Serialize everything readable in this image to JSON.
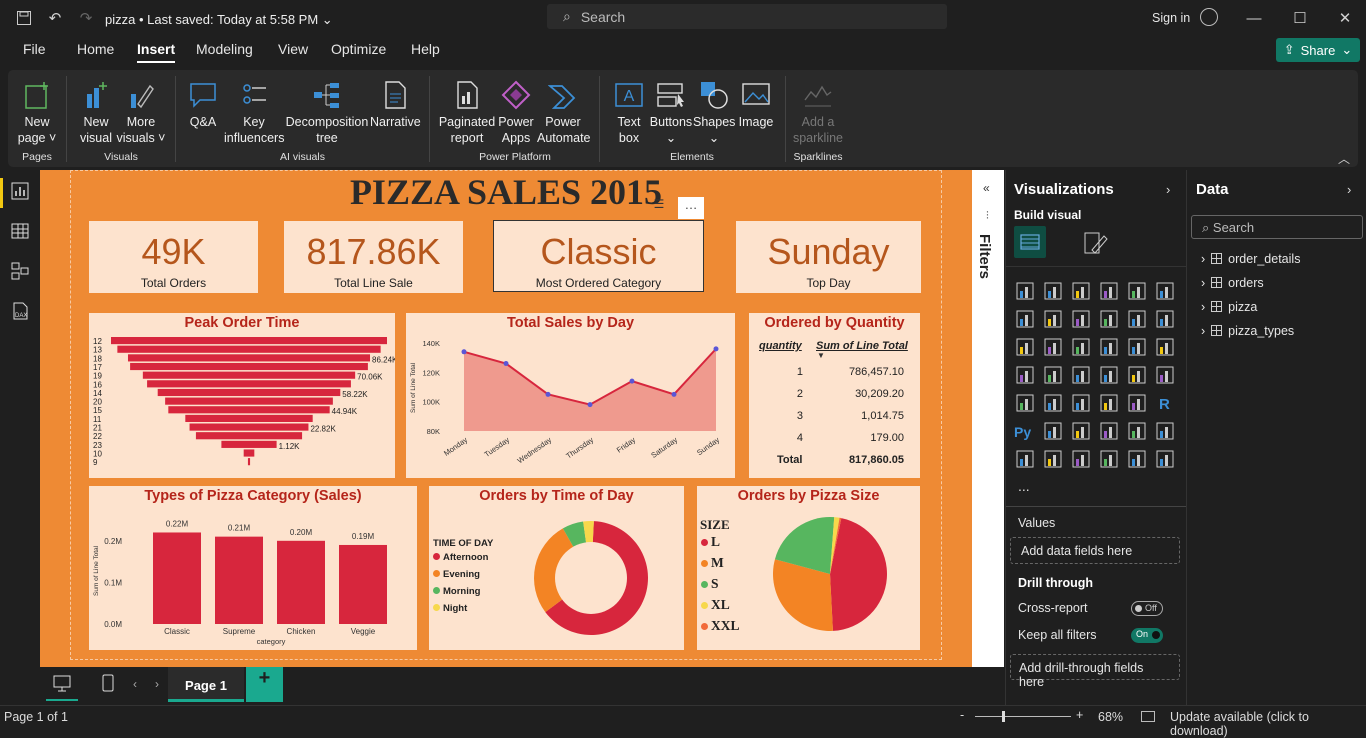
{
  "titlebar": {
    "file_name": "pizza",
    "saved": "Last saved: Today at 5:58 PM",
    "search_placeholder": "Search",
    "sign_in": "Sign in"
  },
  "menu": {
    "items": [
      "File",
      "Home",
      "Insert",
      "Modeling",
      "View",
      "Optimize",
      "Help"
    ],
    "active": "Insert",
    "share": "Share"
  },
  "ribbon": {
    "pages": {
      "new_page": [
        "New",
        "page ˅"
      ],
      "group": "Pages"
    },
    "visuals": {
      "new_visual": [
        "New",
        "visual"
      ],
      "more_visuals": [
        "More",
        "visuals ˅"
      ],
      "group": "Visuals"
    },
    "ai": {
      "qa": "Q&A",
      "key": [
        "Key",
        "influencers"
      ],
      "decomp": [
        "Decomposition",
        "tree"
      ],
      "narrative": "Narrative",
      "group": "AI visuals"
    },
    "power": {
      "paginated": [
        "Paginated",
        "report"
      ],
      "apps": [
        "Power",
        "Apps"
      ],
      "automate": [
        "Power",
        "Automate"
      ],
      "group": "Power Platform"
    },
    "elements": {
      "text": [
        "Text",
        "box"
      ],
      "buttons": "Buttons",
      "shapes": "Shapes",
      "image": "Image",
      "group": "Elements"
    },
    "sparklines": {
      "add": [
        "Add a",
        "sparkline"
      ],
      "group": "Sparklines"
    }
  },
  "report": {
    "title": "PIZZA SALES 2015",
    "kpis": [
      {
        "value": "49K",
        "label": "Total Orders"
      },
      {
        "value": "817.86K",
        "label": "Total Line Sale"
      },
      {
        "value": "Classic",
        "label": "Most Ordered Category"
      },
      {
        "value": "Sunday",
        "label": "Top Day"
      }
    ],
    "colors": {
      "canvas": "#ee8a34",
      "card": "#fde3ce",
      "accent": "#d7263d",
      "title_red": "#b5251a"
    }
  },
  "chart_data": [
    {
      "type": "bar",
      "title": "Peak Order Time",
      "categories": [
        "12",
        "13",
        "18",
        "17",
        "19",
        "16",
        "14",
        "20",
        "15",
        "11",
        "21",
        "22",
        "23",
        "10",
        "9"
      ],
      "values": [
        6.5,
        6.2,
        5.7,
        5.6,
        5.0,
        4.8,
        4.3,
        3.95,
        3.8,
        3.0,
        2.8,
        2.5,
        1.3,
        0.25,
        0.05
      ],
      "data_labels": {
        "2": "86.24K",
        "4": "70.06K",
        "6": "58.22K",
        "8": "44.94K",
        "10": "22.82K",
        "12": "1.12K"
      },
      "style": "funnel"
    },
    {
      "type": "area",
      "title": "Total Sales by Day",
      "categories": [
        "Monday",
        "Tuesday",
        "Wednesday",
        "Thursday",
        "Friday",
        "Saturday",
        "Sunday"
      ],
      "values": [
        134000,
        126000,
        105000,
        98000,
        114000,
        105000,
        136000
      ],
      "ylim": [
        80000,
        140000
      ],
      "yticks": [
        "80K",
        "100K",
        "120K",
        "140K"
      ],
      "ylabel": "Sum of Line Total"
    },
    {
      "type": "table",
      "title": "Ordered by Quantity",
      "columns": [
        "quantity",
        "Sum of Line Total"
      ],
      "rows": [
        [
          "1",
          "786,457.10"
        ],
        [
          "2",
          "30,209.20"
        ],
        [
          "3",
          "1,014.75"
        ],
        [
          "4",
          "179.00"
        ]
      ],
      "total": [
        "Total",
        "817,860.05"
      ]
    },
    {
      "type": "bar",
      "title": "Types of Pizza Category (Sales)",
      "categories": [
        "Classic",
        "Supreme",
        "Chicken",
        "Veggie"
      ],
      "values": [
        0.22,
        0.21,
        0.2,
        0.19
      ],
      "data_labels": [
        "0.22M",
        "0.21M",
        "0.20M",
        "0.19M"
      ],
      "ylim": [
        0,
        0.25
      ],
      "yticks": [
        "0.0M",
        "0.1M",
        "0.2M"
      ],
      "xlabel": "category",
      "ylabel": "Sum of Line Total"
    },
    {
      "type": "pie",
      "title": "Orders by Time of Day",
      "legend_title": "TIME OF DAY",
      "labels": [
        "Afternoon",
        "Evening",
        "Morning",
        "Night"
      ],
      "values": [
        0.64,
        0.27,
        0.06,
        0.03
      ],
      "colors": [
        "#d7263d",
        "#f38424",
        "#57b65f",
        "#f7d84b"
      ],
      "donut": true
    },
    {
      "type": "pie",
      "title": "Orders by Pizza Size",
      "legend_title": "SIZE",
      "labels": [
        "L",
        "M",
        "S",
        "XL",
        "XXL"
      ],
      "values": [
        0.46,
        0.3,
        0.22,
        0.015,
        0.005
      ],
      "colors": [
        "#d7263d",
        "#f38424",
        "#57b65f",
        "#f7d84b",
        "#f26a3a"
      ]
    }
  ],
  "filters": {
    "label": "Filters"
  },
  "visualizations": {
    "title": "Visualizations",
    "build": "Build visual",
    "values": "Values",
    "add_data": "Add data fields here",
    "drill": "Drill through",
    "cross": "Cross-report",
    "cross_state": "Off",
    "keep": "Keep all filters",
    "keep_state": "On",
    "add_drill": "Add drill-through fields here",
    "more": "..."
  },
  "data_pane": {
    "title": "Data",
    "search": "Search",
    "tables": [
      "order_details",
      "orders",
      "pizza",
      "pizza_types"
    ]
  },
  "pages": {
    "tab": "Page 1",
    "add": "+"
  },
  "status": {
    "page": "Page 1 of 1",
    "zoom": "68%",
    "update": "Update available (click to download)"
  }
}
